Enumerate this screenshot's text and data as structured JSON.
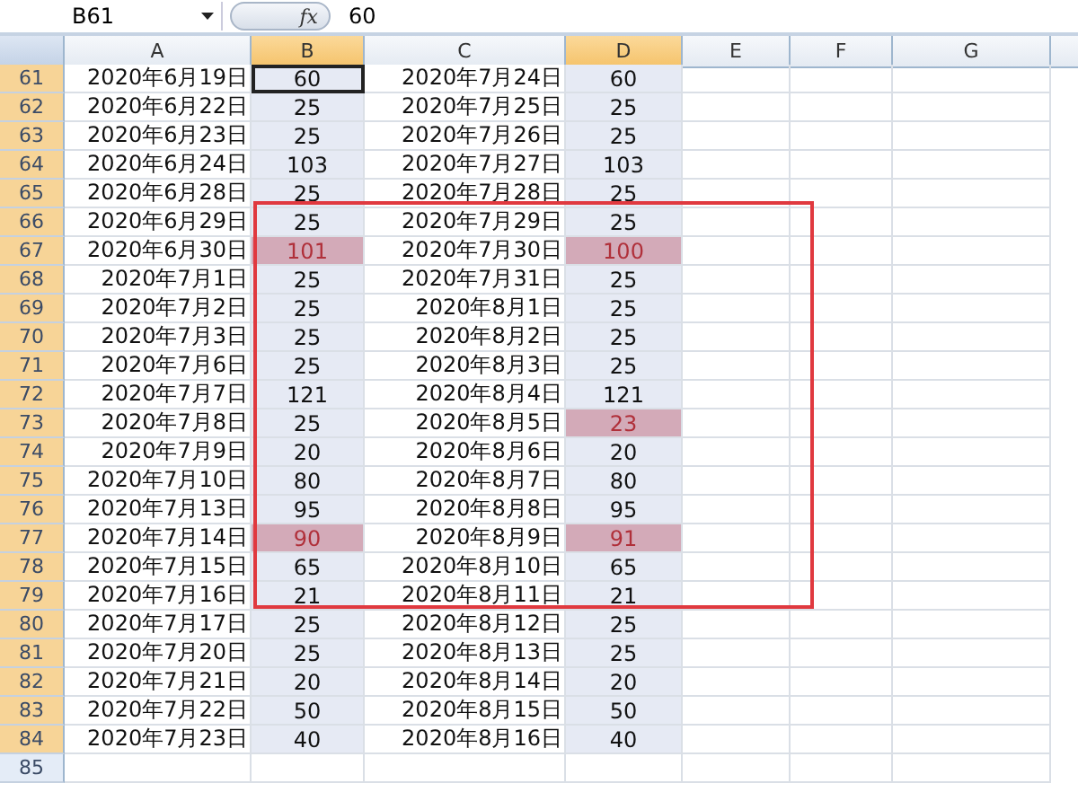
{
  "formula_bar": {
    "name_box": "B61",
    "fx_label": "fx",
    "formula": "60"
  },
  "columns": [
    {
      "label": "A",
      "selected": false
    },
    {
      "label": "B",
      "selected": true
    },
    {
      "label": "C",
      "selected": false
    },
    {
      "label": "D",
      "selected": true
    },
    {
      "label": "E",
      "selected": false
    },
    {
      "label": "F",
      "selected": false
    },
    {
      "label": "G",
      "selected": false
    }
  ],
  "rows": [
    {
      "number": "61",
      "selected": true,
      "a": "2020年6月19日",
      "b": {
        "text": "60",
        "highlighted": false,
        "active": true
      },
      "c": "2020年7月24日",
      "d": {
        "text": "60",
        "highlighted": false
      }
    },
    {
      "number": "62",
      "selected": true,
      "a": "2020年6月22日",
      "b": {
        "text": "25",
        "highlighted": false,
        "active": false
      },
      "c": "2020年7月25日",
      "d": {
        "text": "25",
        "highlighted": false
      }
    },
    {
      "number": "63",
      "selected": true,
      "a": "2020年6月23日",
      "b": {
        "text": "25",
        "highlighted": false,
        "active": false
      },
      "c": "2020年7月26日",
      "d": {
        "text": "25",
        "highlighted": false
      }
    },
    {
      "number": "64",
      "selected": true,
      "a": "2020年6月24日",
      "b": {
        "text": "103",
        "highlighted": false,
        "active": false
      },
      "c": "2020年7月27日",
      "d": {
        "text": "103",
        "highlighted": false
      }
    },
    {
      "number": "65",
      "selected": true,
      "a": "2020年6月28日",
      "b": {
        "text": "25",
        "highlighted": false,
        "active": false
      },
      "c": "2020年7月28日",
      "d": {
        "text": "25",
        "highlighted": false
      }
    },
    {
      "number": "66",
      "selected": true,
      "a": "2020年6月29日",
      "b": {
        "text": "25",
        "highlighted": false,
        "active": false
      },
      "c": "2020年7月29日",
      "d": {
        "text": "25",
        "highlighted": false
      }
    },
    {
      "number": "67",
      "selected": true,
      "a": "2020年6月30日",
      "b": {
        "text": "101",
        "highlighted": true,
        "active": false
      },
      "c": "2020年7月30日",
      "d": {
        "text": "100",
        "highlighted": true
      }
    },
    {
      "number": "68",
      "selected": true,
      "a": "2020年7月1日",
      "b": {
        "text": "25",
        "highlighted": false,
        "active": false
      },
      "c": "2020年7月31日",
      "d": {
        "text": "25",
        "highlighted": false
      }
    },
    {
      "number": "69",
      "selected": true,
      "a": "2020年7月2日",
      "b": {
        "text": "25",
        "highlighted": false,
        "active": false
      },
      "c": "2020年8月1日",
      "d": {
        "text": "25",
        "highlighted": false
      }
    },
    {
      "number": "70",
      "selected": true,
      "a": "2020年7月3日",
      "b": {
        "text": "25",
        "highlighted": false,
        "active": false
      },
      "c": "2020年8月2日",
      "d": {
        "text": "25",
        "highlighted": false
      }
    },
    {
      "number": "71",
      "selected": true,
      "a": "2020年7月6日",
      "b": {
        "text": "25",
        "highlighted": false,
        "active": false
      },
      "c": "2020年8月3日",
      "d": {
        "text": "25",
        "highlighted": false
      }
    },
    {
      "number": "72",
      "selected": true,
      "a": "2020年7月7日",
      "b": {
        "text": "121",
        "highlighted": false,
        "active": false
      },
      "c": "2020年8月4日",
      "d": {
        "text": "121",
        "highlighted": false
      }
    },
    {
      "number": "73",
      "selected": true,
      "a": "2020年7月8日",
      "b": {
        "text": "25",
        "highlighted": false,
        "active": false
      },
      "c": "2020年8月5日",
      "d": {
        "text": "23",
        "highlighted": true
      }
    },
    {
      "number": "74",
      "selected": true,
      "a": "2020年7月9日",
      "b": {
        "text": "20",
        "highlighted": false,
        "active": false
      },
      "c": "2020年8月6日",
      "d": {
        "text": "20",
        "highlighted": false
      }
    },
    {
      "number": "75",
      "selected": true,
      "a": "2020年7月10日",
      "b": {
        "text": "80",
        "highlighted": false,
        "active": false
      },
      "c": "2020年8月7日",
      "d": {
        "text": "80",
        "highlighted": false
      }
    },
    {
      "number": "76",
      "selected": true,
      "a": "2020年7月13日",
      "b": {
        "text": "95",
        "highlighted": false,
        "active": false
      },
      "c": "2020年8月8日",
      "d": {
        "text": "95",
        "highlighted": false
      }
    },
    {
      "number": "77",
      "selected": true,
      "a": "2020年7月14日",
      "b": {
        "text": "90",
        "highlighted": true,
        "active": false
      },
      "c": "2020年8月9日",
      "d": {
        "text": "91",
        "highlighted": true
      }
    },
    {
      "number": "78",
      "selected": true,
      "a": "2020年7月15日",
      "b": {
        "text": "65",
        "highlighted": false,
        "active": false
      },
      "c": "2020年8月10日",
      "d": {
        "text": "65",
        "highlighted": false
      }
    },
    {
      "number": "79",
      "selected": true,
      "a": "2020年7月16日",
      "b": {
        "text": "21",
        "highlighted": false,
        "active": false
      },
      "c": "2020年8月11日",
      "d": {
        "text": "21",
        "highlighted": false
      }
    },
    {
      "number": "80",
      "selected": true,
      "a": "2020年7月17日",
      "b": {
        "text": "25",
        "highlighted": false,
        "active": false
      },
      "c": "2020年8月12日",
      "d": {
        "text": "25",
        "highlighted": false
      }
    },
    {
      "number": "81",
      "selected": true,
      "a": "2020年7月20日",
      "b": {
        "text": "25",
        "highlighted": false,
        "active": false
      },
      "c": "2020年8月13日",
      "d": {
        "text": "25",
        "highlighted": false
      }
    },
    {
      "number": "82",
      "selected": true,
      "a": "2020年7月21日",
      "b": {
        "text": "20",
        "highlighted": false,
        "active": false
      },
      "c": "2020年8月14日",
      "d": {
        "text": "20",
        "highlighted": false
      }
    },
    {
      "number": "83",
      "selected": true,
      "a": "2020年7月22日",
      "b": {
        "text": "50",
        "highlighted": false,
        "active": false
      },
      "c": "2020年8月15日",
      "d": {
        "text": "50",
        "highlighted": false
      }
    },
    {
      "number": "84",
      "selected": true,
      "a": "2020年7月23日",
      "b": {
        "text": "40",
        "highlighted": false,
        "active": false
      },
      "c": "2020年8月16日",
      "d": {
        "text": "40",
        "highlighted": false
      }
    },
    {
      "number": "85",
      "selected": false
    }
  ]
}
